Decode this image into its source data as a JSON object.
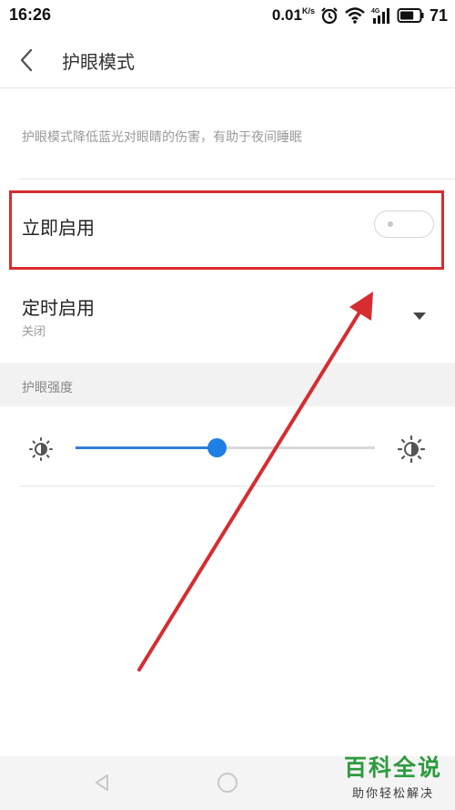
{
  "status_bar": {
    "time": "16:26",
    "speed": "0.01",
    "speed_unit": "K/s",
    "network": "4G",
    "battery": "71",
    "battery_level": 0.71
  },
  "header": {
    "title": "护眼模式"
  },
  "description": "护眼模式降低蓝光对眼睛的伤害，有助于夜间睡眠",
  "instant_enable": {
    "label": "立即启用",
    "enabled": false
  },
  "schedule_enable": {
    "label": "定时启用",
    "value": "关闭"
  },
  "intensity": {
    "section_label": "护眼强度",
    "level": 0.47
  },
  "watermark": {
    "title": "百科全说",
    "subtitle": "助你轻松解决"
  },
  "colors": {
    "accent": "#1e7fe4",
    "highlight": "#d72c30",
    "watermark_green": "#2c9b3d"
  },
  "icons": [
    "back-icon",
    "alarm-icon",
    "wifi-icon",
    "signal-icon",
    "battery-icon",
    "brightness-low-icon",
    "brightness-high-icon",
    "nav-back-icon",
    "nav-home-icon"
  ]
}
